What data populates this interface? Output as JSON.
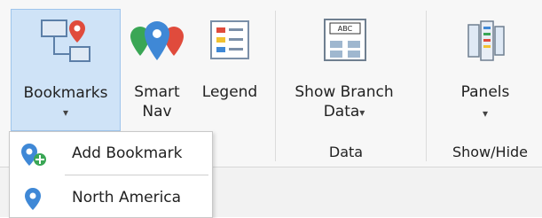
{
  "ribbon": {
    "buttons": {
      "bookmarks": {
        "label": "Bookmarks",
        "caret": "▾",
        "icon": "bookmarks-icon"
      },
      "smart_nav": {
        "label_line1": "Smart",
        "label_line2": "Nav",
        "icon": "smart-nav-icon"
      },
      "legend": {
        "label": "Legend",
        "icon": "legend-icon"
      },
      "show_branch_data": {
        "label_line1": "Show Branch",
        "label_line2": "Data",
        "caret": "▾",
        "icon": "branch-data-icon",
        "icon_text": "ABC"
      },
      "panels": {
        "label": "Panels",
        "caret": "▾",
        "icon": "panels-icon"
      }
    },
    "groups": {
      "data": "Data",
      "show_hide": "Show/Hide"
    }
  },
  "bookmarks_menu": {
    "items": [
      {
        "label": "Add Bookmark",
        "icon": "add-bookmark-icon"
      },
      {
        "label": "North America",
        "icon": "map-pin-icon"
      }
    ]
  },
  "colors": {
    "selected_bg": "#cfe3f7",
    "pin_blue": "#3f88d6",
    "pin_red": "#e04b3c",
    "pin_green": "#3aa655"
  }
}
